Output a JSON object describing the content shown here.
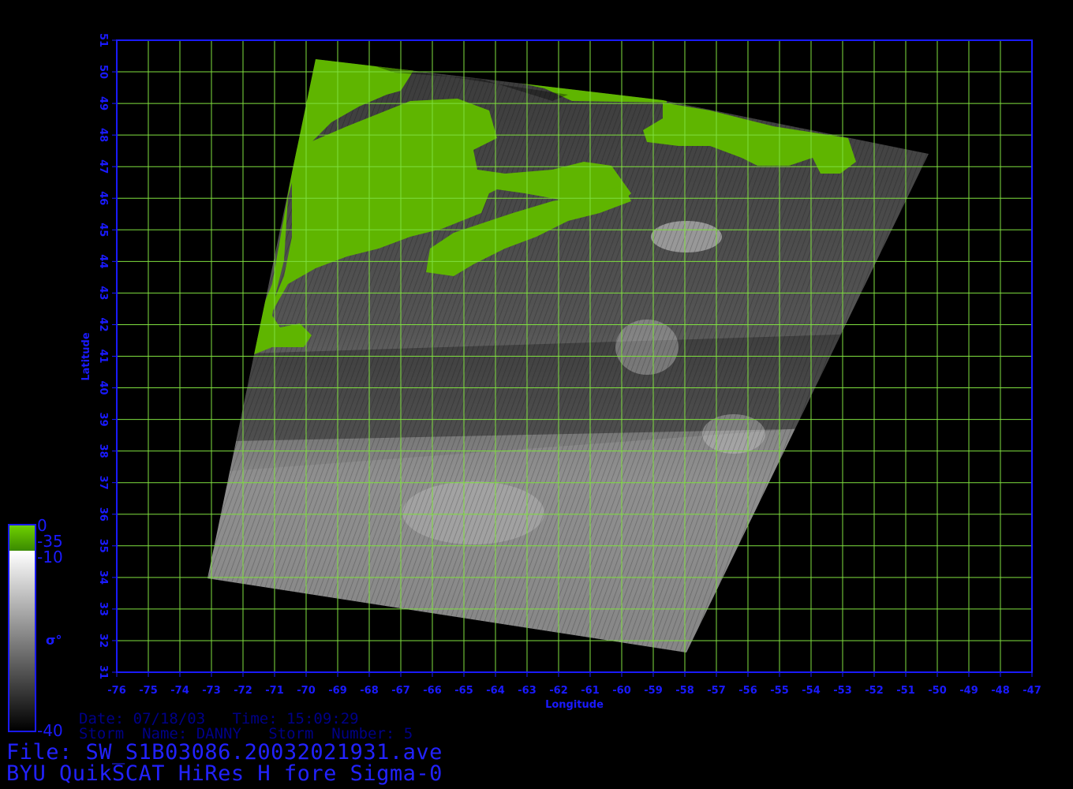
{
  "map": {
    "lon_ticks": [
      -76,
      -75,
      -74,
      -73,
      -72,
      -71,
      -70,
      -69,
      -68,
      -67,
      -66,
      -65,
      -64,
      -63,
      -62,
      -61,
      -60,
      -59,
      -58,
      -57,
      -56,
      -55,
      -54,
      -53,
      -52,
      -51,
      -50,
      -49,
      -48,
      -47
    ],
    "lat_ticks": [
      31,
      32,
      33,
      34,
      35,
      36,
      37,
      38,
      39,
      40,
      41,
      42,
      43,
      44,
      45,
      46,
      47,
      48,
      49,
      50,
      51
    ],
    "xlabel": "Longitude",
    "ylabel": "Latitude",
    "grid": true,
    "colors": {
      "grid": "#7fdf3f",
      "axis": "#1a1aff",
      "land": "#5fb500",
      "background": "#000000"
    }
  },
  "colorbar": {
    "land_top": "0",
    "land_bottom": "-35",
    "ocean_top": "-10",
    "ocean_bottom": "-40",
    "symbol": "σ°"
  },
  "info": {
    "date_line": "Date: 07/18/03   Time: 15:09:29",
    "storm_line": "Storm  Name: DANNY   Storm  Number: 5",
    "file_line": "File: SW_S1B03086.20032021931.ave",
    "product_line": "BYU QuikSCAT HiRes H fore Sigma-0"
  }
}
